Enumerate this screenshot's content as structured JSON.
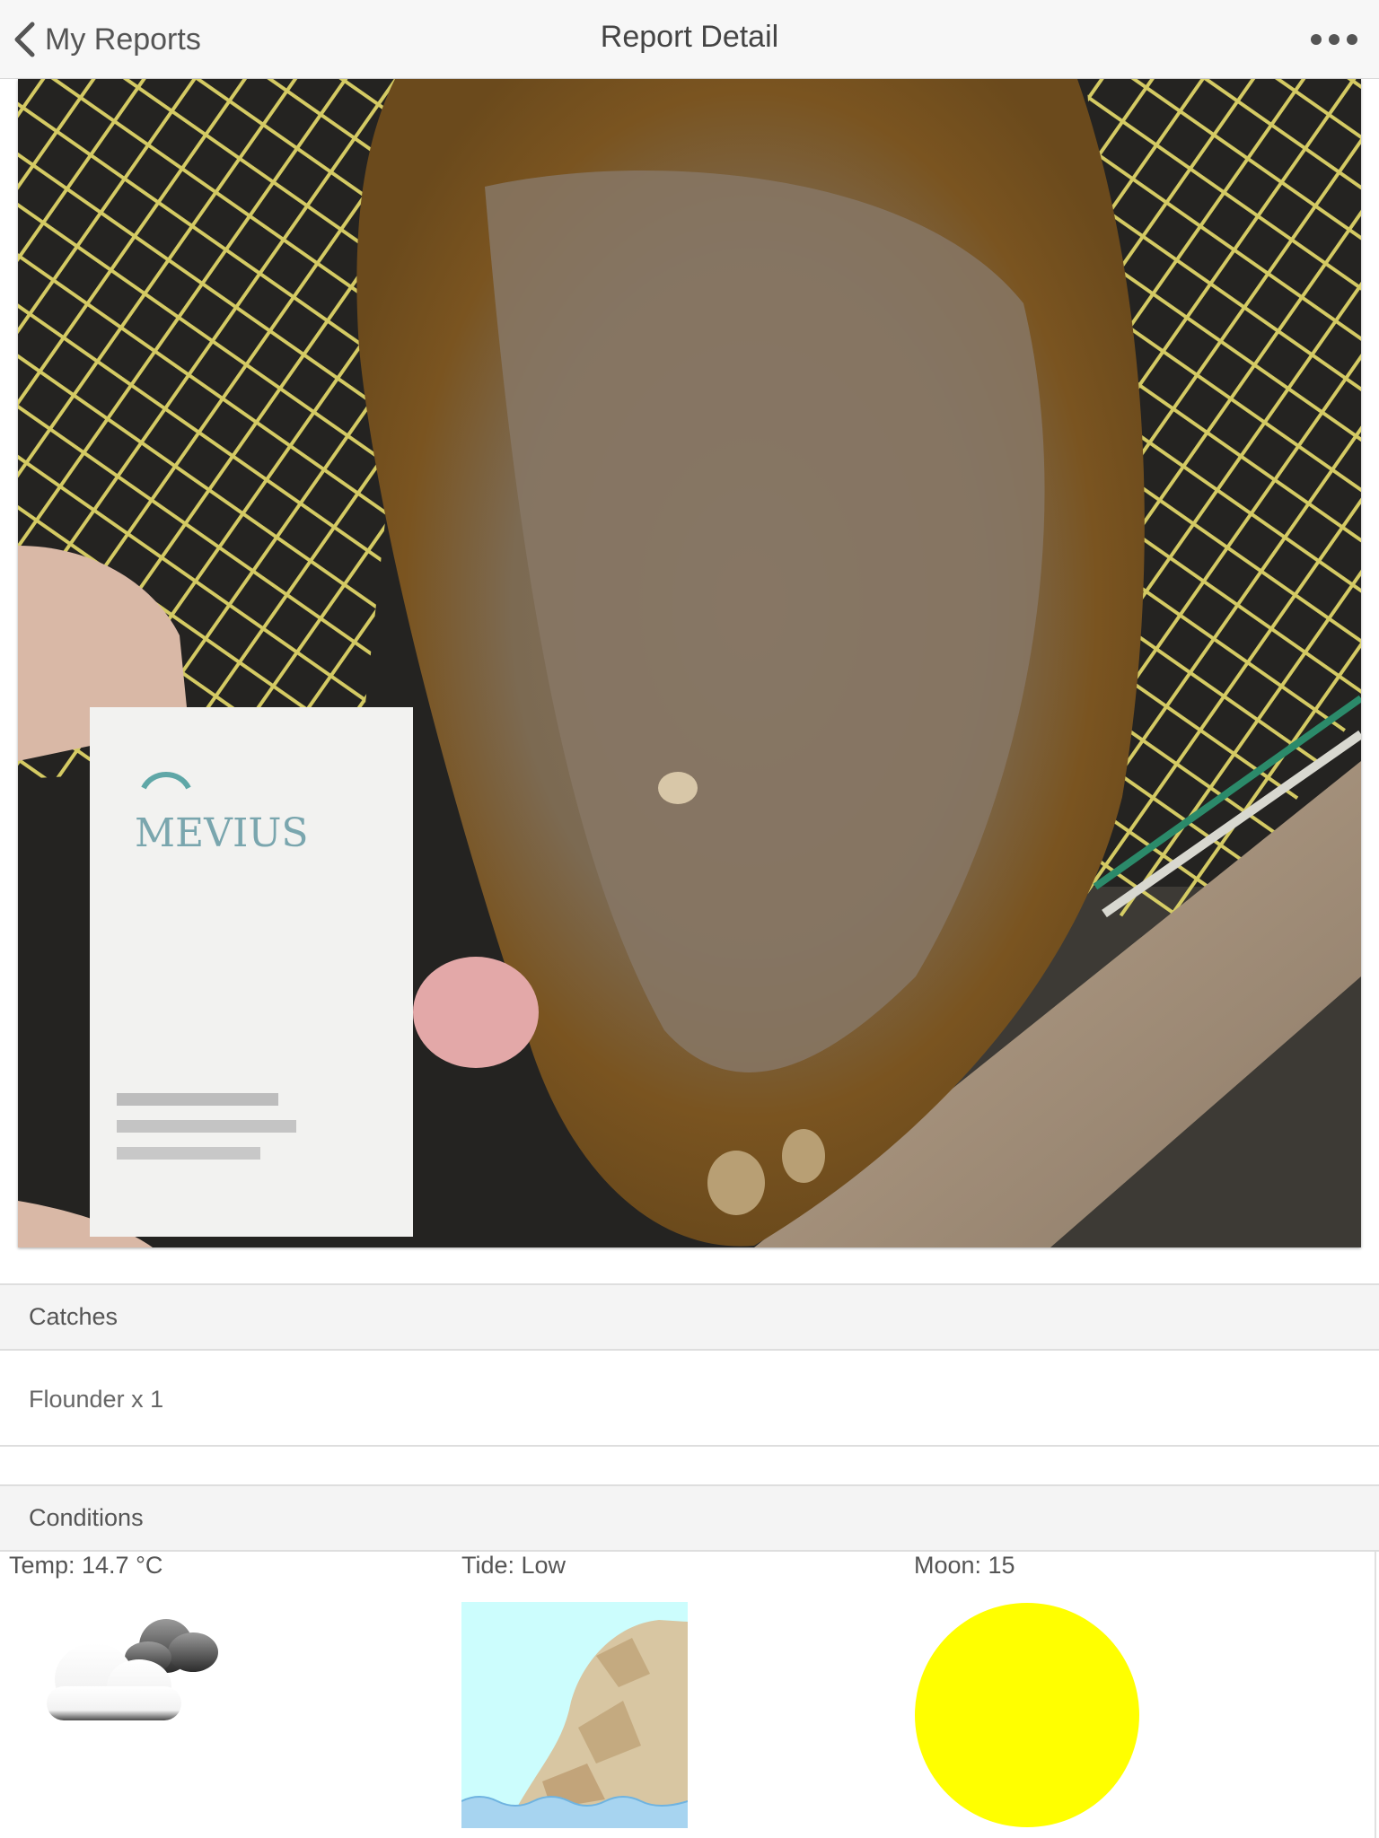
{
  "navbar": {
    "back_label": "My Reports",
    "title": "Report Detail",
    "more_icon": "ellipsis-icon"
  },
  "photo": {
    "card_text": "MEVIUS"
  },
  "catches": {
    "header": "Catches",
    "items": [
      "Flounder x 1"
    ]
  },
  "conditions": {
    "header": "Conditions",
    "temp_label": "Temp: 14.7 °C",
    "tide_label": "Tide: Low",
    "moon_label": "Moon: 15",
    "weather_icon": "cloudy-icon",
    "tide_icon": "low-tide-icon",
    "moon_icon": "full-moon-icon",
    "moon_color": "#ffff00"
  }
}
